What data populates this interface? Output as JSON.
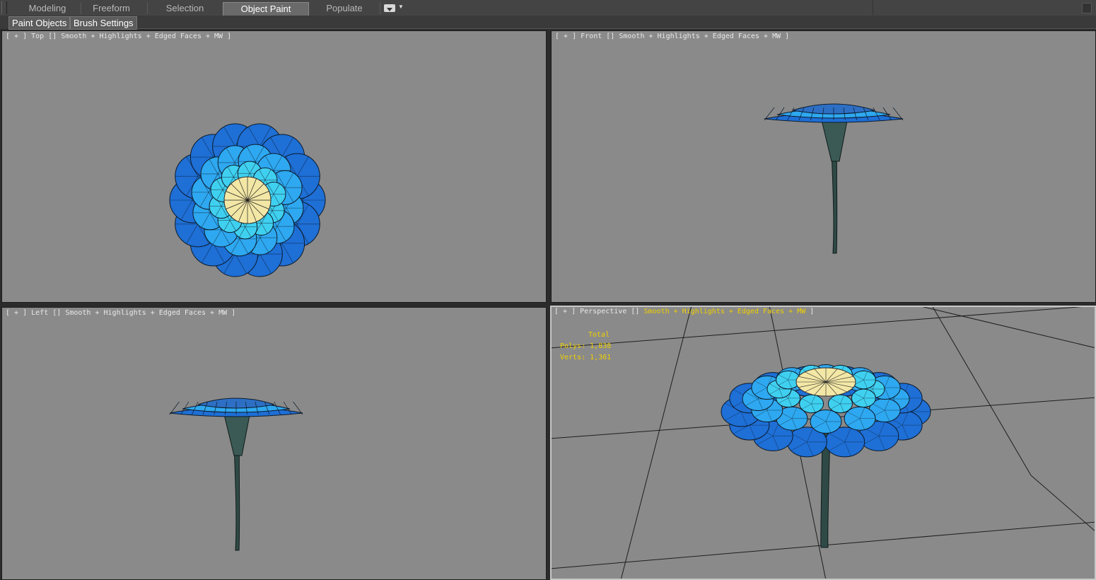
{
  "ribbon": {
    "tabs": [
      {
        "label": "Modeling"
      },
      {
        "label": "Freeform"
      },
      {
        "label": "Selection"
      },
      {
        "label": "Object Paint"
      },
      {
        "label": "Populate"
      }
    ],
    "active_tab": "Object Paint"
  },
  "subbar": {
    "paint_objects": "Paint Objects",
    "brush_settings": "Brush Settings"
  },
  "viewports": {
    "top": {
      "plus": "[ + ]",
      "name": "Top",
      "mode": "Smooth + Highlights + Edged Faces + MW",
      "close": "]"
    },
    "front": {
      "plus": "[ + ]",
      "name": "Front",
      "mode": "Smooth + Highlights + Edged Faces + MW",
      "close": "]"
    },
    "left": {
      "plus": "[ + ]",
      "name": "Left",
      "mode": "Smooth + Highlights + Edged Faces + MW",
      "close": "]"
    },
    "perspective": {
      "plus": "[ + ]",
      "name": "Perspective",
      "mode": "Smooth + Highlights + Edged Faces + MW",
      "close": "]"
    }
  },
  "stats": {
    "header": "Total",
    "polys_label": "Polys:",
    "polys_value": "1,838",
    "verts_label": "Verts:",
    "verts_value": "1,361"
  },
  "colors": {
    "viewport_bg": "#8a8a8a",
    "petal_outer": "#1e6fd6",
    "petal_mid": "#2ea8f0",
    "petal_inner": "#3fd0f0",
    "center": "#f3e7a6",
    "stem": "#2f4a46",
    "highlight_text": "#f0d000"
  },
  "icons": {
    "ribbon_dropdown": "dropdown-icon"
  }
}
